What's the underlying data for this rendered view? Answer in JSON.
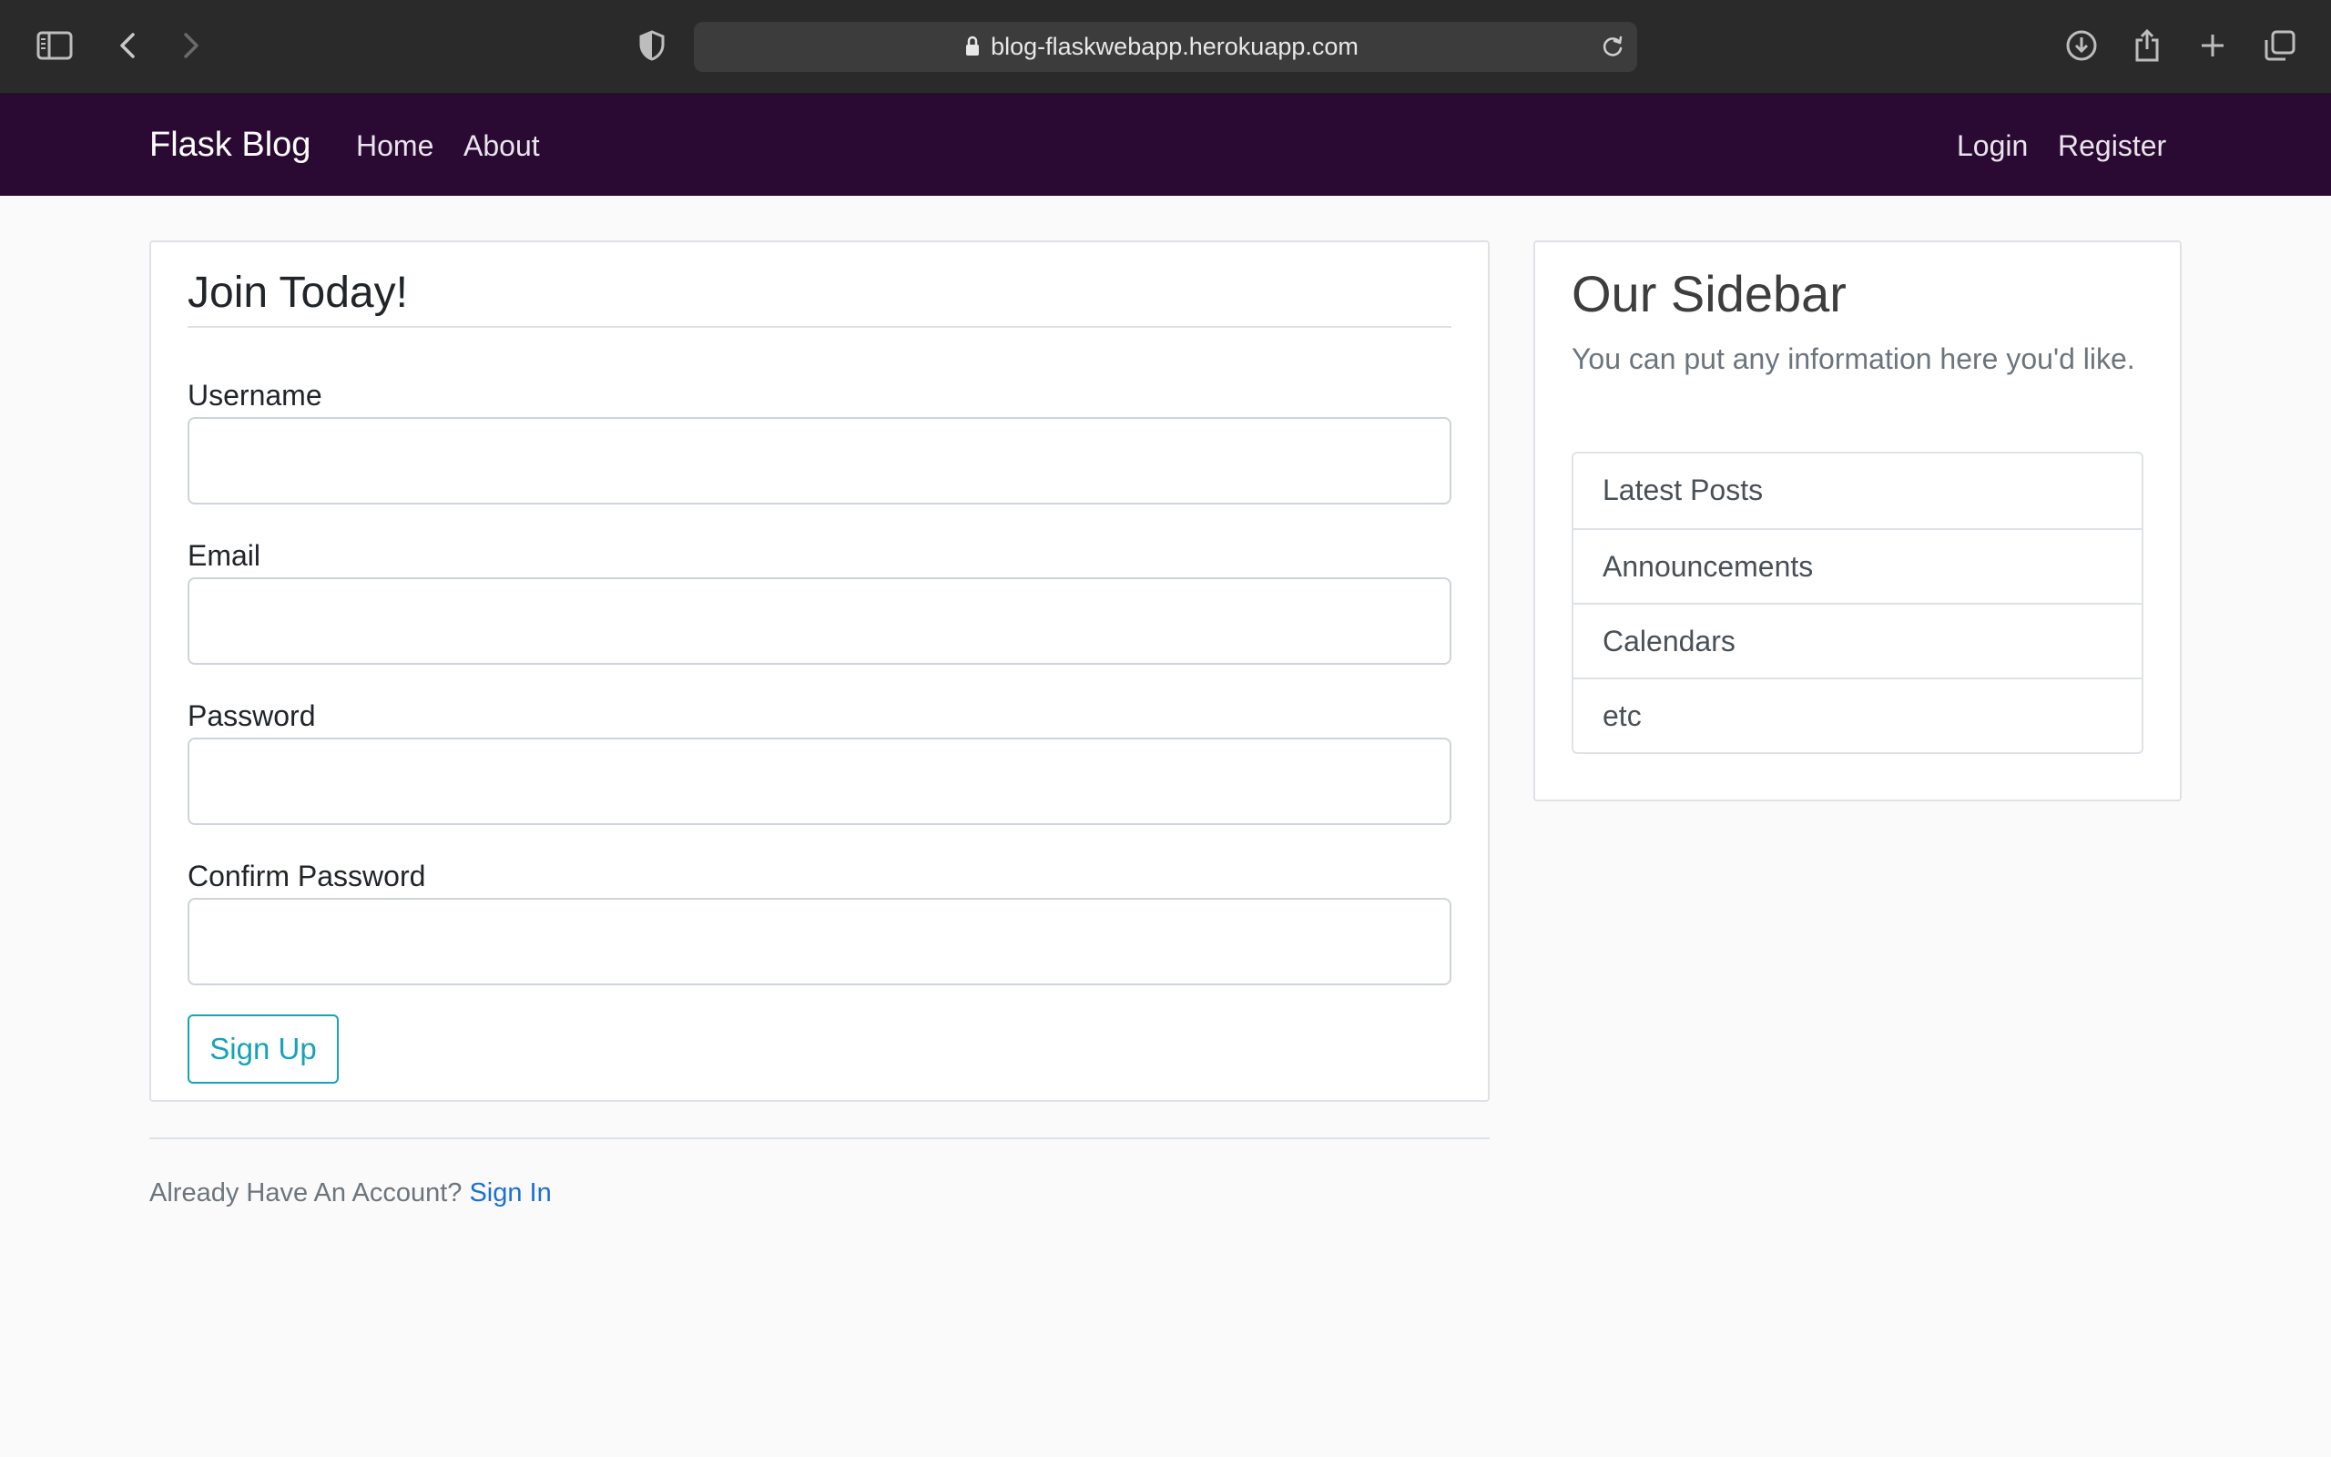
{
  "browser": {
    "url": "blog-flaskwebapp.herokuapp.com"
  },
  "navbar": {
    "brand": "Flask Blog",
    "links": [
      "Home",
      "About"
    ],
    "right_links": [
      "Login",
      "Register"
    ],
    "background": "#2a0a33"
  },
  "form": {
    "legend": "Join Today!",
    "fields": [
      {
        "label": "Username",
        "value": ""
      },
      {
        "label": "Email",
        "value": ""
      },
      {
        "label": "Password",
        "value": ""
      },
      {
        "label": "Confirm Password",
        "value": ""
      }
    ],
    "submit_label": "Sign Up",
    "accent": "#17a2b8"
  },
  "footer": {
    "prompt": "Already Have An Account?",
    "link": "Sign In",
    "link_color": "#1a6fdc"
  },
  "sidebar": {
    "title": "Our Sidebar",
    "text": "You can put any information here you'd like.",
    "items": [
      "Latest Posts",
      "Announcements",
      "Calendars",
      "etc"
    ]
  }
}
